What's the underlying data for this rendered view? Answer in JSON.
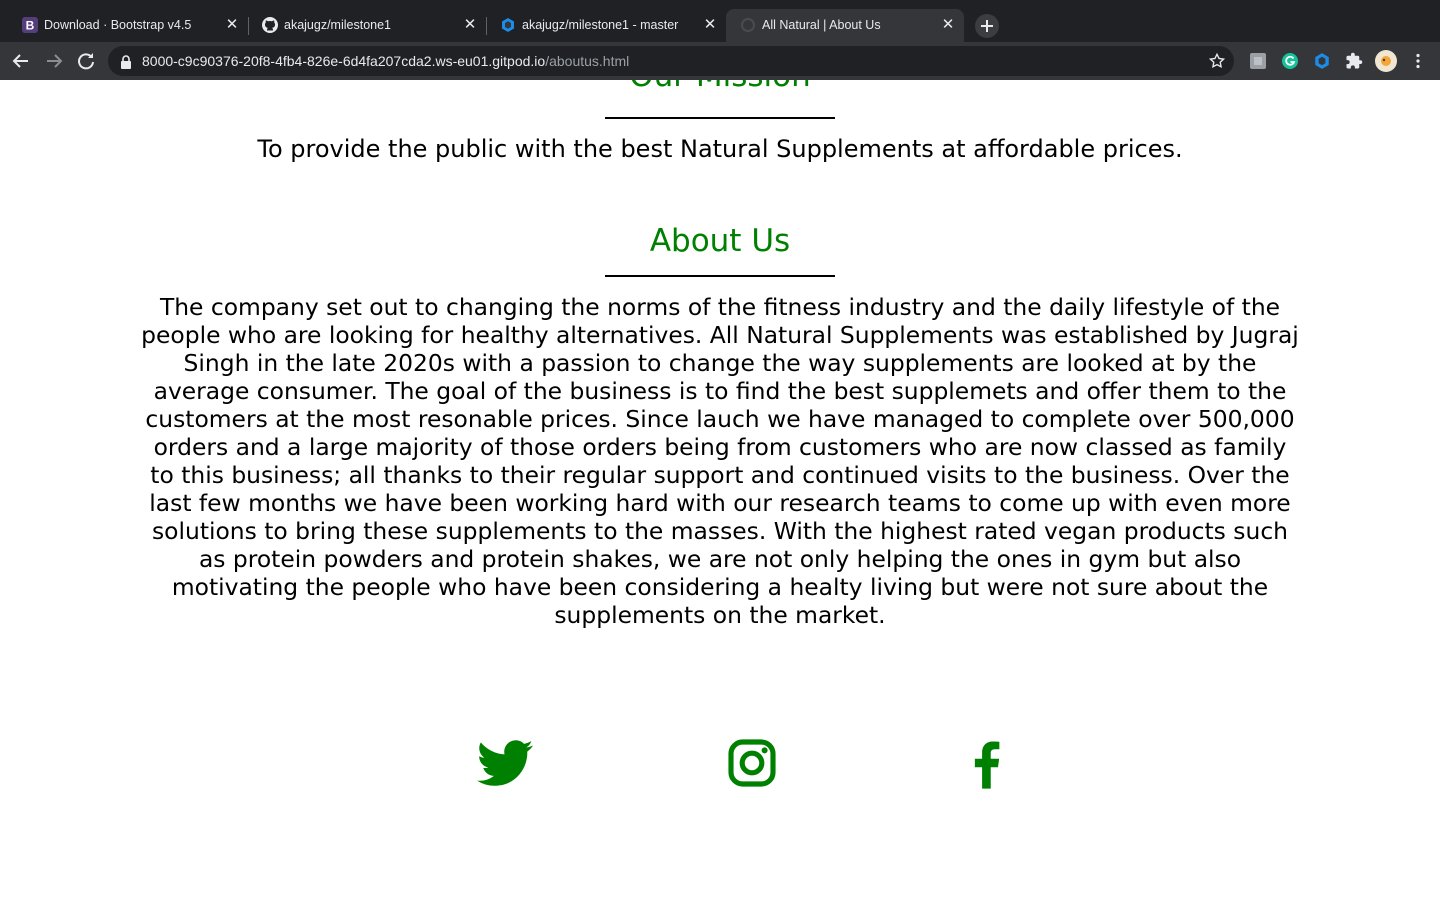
{
  "browser": {
    "tabs": [
      {
        "title": "Download · Bootstrap v4.5",
        "favicon": "bootstrap-icon",
        "active": false
      },
      {
        "title": "akajugz/milestone1",
        "favicon": "github-icon",
        "active": false
      },
      {
        "title": "akajugz/milestone1 - master",
        "favicon": "gitpod-icon",
        "active": false
      },
      {
        "title": "All Natural | About Us",
        "favicon": "loading-icon",
        "active": true
      }
    ],
    "url_main": "8000-c9c90376-20f8-4fb4-826e-6d4fa207cda2.ws-eu01.gitpod.io",
    "url_path": "/aboutus.html"
  },
  "page": {
    "mission_heading": "Our Mission",
    "mission_text": "To provide the public with the best Natural Supplements at affordable prices.",
    "about_heading": "About Us",
    "about_text": "The company set out to changing the norms of the fitness industry and the daily lifestyle of the people who are looking for healthy alternatives. All Natural Supplements was established by Jugraj Singh in the late 2020s with a passion to change the way supplements are looked at by the average consumer. The goal of the business is to find the best supplemets and offer them to the customers at the most resonable prices. Since lauch we have managed to complete over 500,000 orders and a large majority of those orders being from customers who are now classed as family to this business; all thanks to their regular support and continued visits to the business. Over the last few months we have been working hard with our research teams to come up with even more solutions to bring these supplements to the masses. With the highest rated vegan products such as protein powders and protein shakes, we are not only helping the ones in gym but also motivating the people who have been considering a healty living but were not sure about the supplements on the market.",
    "social": [
      "twitter-icon",
      "instagram-icon",
      "facebook-icon"
    ]
  },
  "colors": {
    "accent_green": "#008000",
    "chrome_dark": "#202124",
    "chrome_toolbar": "#35363a"
  }
}
